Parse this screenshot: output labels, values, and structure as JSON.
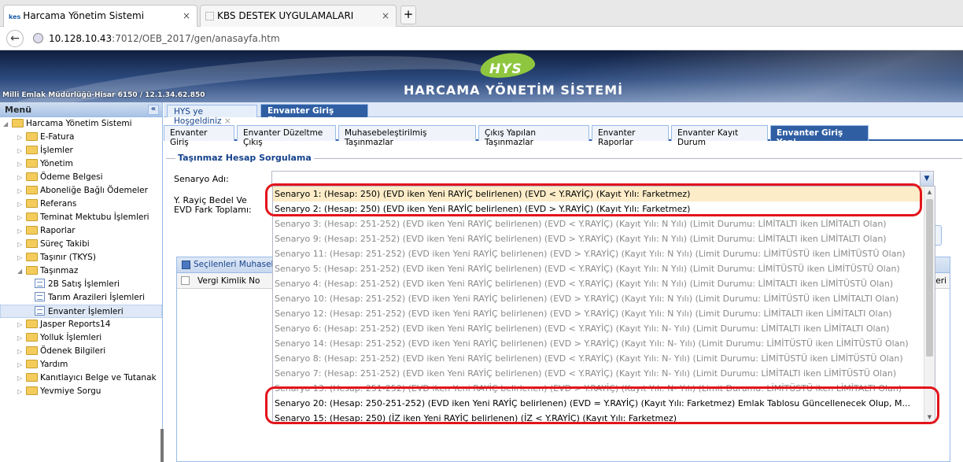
{
  "browser": {
    "tabs": [
      {
        "favicon": "kes",
        "title": "Harcama Yönetim Sistemi",
        "close": "×"
      },
      {
        "favicon": "",
        "title": "KBS DESTEK UYGULAMALARI",
        "close": "×"
      }
    ],
    "new_tab": "+",
    "url_host": "10.128.10.43",
    "url_path": ":7012/OEB_2017/gen/anasayfa.htm"
  },
  "banner": {
    "logo": "HYS",
    "system_title": "HARCAMA YÖNETİM SİSTEMİ",
    "unit_info": "Milli Emlak Müdürlüğü-Hisar 6150 / 12.1.34.62.850"
  },
  "menu": {
    "header": "Menü",
    "collapse": "«",
    "root": "Harcama Yönetim Sistemi",
    "items": [
      "E-Fatura",
      "İşlemler",
      "Yönetim",
      "Ödeme Belgesi",
      "Aboneliğe Bağlı Ödemeler",
      "Referans",
      "Teminat Mektubu İşlemleri",
      "Raporlar",
      "Süreç Takibi",
      "Taşınır (TKYS)"
    ],
    "open_item": "Taşınmaz",
    "subitems": [
      "2B Satış İşlemleri",
      "Tarım Arazileri İşlemleri",
      "Envanter İşlemleri"
    ],
    "items_after": [
      "Jasper Reports14",
      "Yolluk İşlemleri",
      "Ödenek Bilgileri",
      "Yardım",
      "Kanıtlayıcı Belge ve Tutanak",
      "Yevmiye Sorgu"
    ]
  },
  "outer_tabs": [
    {
      "label": "HYS ye Hoşgeldiniz",
      "close": "×"
    },
    {
      "label": "Envanter Giriş Ekranı",
      "close": "×"
    }
  ],
  "inner_tabs": [
    "Envanter Giriş",
    "Envanter Düzeltme Çıkış",
    "Muhasebeleştirilmiş Taşınmazlar",
    "Çıkış Yapılan Taşınmazlar",
    "Envanter Raporlar",
    "Envanter Kayıt Durum",
    "Envanter Giriş Yeni"
  ],
  "form": {
    "legend": "Taşınmaz Hesap Sorgulama",
    "senaryo_label": "Senaryo Adı:",
    "rayic_label_1": "Y. Rayiç Bedel Ve",
    "rayic_label_2": "EVD Fark Toplamı:"
  },
  "grid": {
    "title": "Seçilenleri Muhasebe",
    "col_vkn": "Vergi Kimlik No",
    "col_end": "eri"
  },
  "dropdown": {
    "options": [
      "Senaryo 1: (Hesap: 250) (EVD iken Yeni RAYİÇ belirlenen) (EVD < Y.RAYİÇ) (Kayıt Yılı: Farketmez)",
      "Senaryo 2: (Hesap: 250) (EVD iken Yeni RAYİÇ belirlenen) (EVD > Y.RAYİÇ) (Kayıt Yılı: Farketmez)",
      "Senaryo 3: (Hesap: 251-252) (EVD iken Yeni RAYİÇ belirlenen) (EVD < Y.RAYİÇ) (Kayıt Yılı: N Yılı) (Limit Durumu: LİMİTALTI iken LİMİTALTI Olan)",
      "Senaryo 9: (Hesap: 251-252) (EVD iken Yeni RAYİÇ belirlenen) (EVD > Y.RAYİÇ) (Kayıt Yılı: N Yılı) (Limit Durumu: LİMİTALTI iken LİMİTALTI Olan)",
      "Senaryo 11: (Hesap: 251-252) (EVD iken Yeni RAYİÇ belirlenen) (EVD > Y.RAYİÇ) (Kayıt Yılı: N Yılı) (Limit Durumu: LİMİTÜSTÜ iken LİMİTÜSTÜ Olan)",
      "Senaryo 5: (Hesap: 251-252) (EVD iken Yeni RAYİÇ belirlenen) (EVD < Y.RAYİÇ) (Kayıt Yılı: N Yılı) (Limit Durumu: LİMİTÜSTÜ iken LİMİTÜSTÜ Olan)",
      "Senaryo 4: (Hesap: 251-252) (EVD iken Yeni RAYİÇ belirlenen) (EVD < Y.RAYİÇ) (Kayıt Yılı: N Yılı) (Limit Durumu: LİMİTALTI iken LİMİTÜSTÜ Olan)",
      "Senaryo 10: (Hesap: 251-252) (EVD iken Yeni RAYİÇ belirlenen) (EVD > Y.RAYİÇ) (Kayıt Yılı: N Yılı) (Limit Durumu: LİMİTÜSTÜ iken LİMİTALTI Olan)",
      "Senaryo 12: (Hesap: 251-252) (EVD iken Yeni RAYİÇ belirlenen) (EVD > Y.RAYİÇ) (Kayıt Yılı: N Yılı) (Limit Durumu: LİMİTALTI iken LİMİTALTI Olan)",
      "Senaryo 6: (Hesap: 251-252) (EVD iken Yeni RAYİÇ belirlenen) (EVD < Y.RAYİÇ) (Kayıt Yılı: N- Yılı) (Limit Durumu: LİMİTALTI iken LİMİTALTI Olan)",
      "Senaryo 14: (Hesap: 251-252) (EVD iken Yeni RAYİÇ belirlenen) (EVD > Y.RAYİÇ) (Kayıt Yılı: N- Yılı) (Limit Durumu: LİMİTÜSTÜ iken LİMİTÜSTÜ Olan)",
      "Senaryo 8: (Hesap: 251-252) (EVD iken Yeni RAYİÇ belirlenen) (EVD < Y.RAYİÇ) (Kayıt Yılı: N- Yılı) (Limit Durumu: LİMİTÜSTÜ iken LİMİTÜSTÜ Olan)",
      "Senaryo 7: (Hesap: 251-252) (EVD iken Yeni RAYİÇ belirlenen) (EVD < Y.RAYİÇ) (Kayıt Yılı: N- Yılı) (Limit Durumu: LİMİTALTI iken LİMİTÜSTÜ Olan)",
      "Senaryo 13: (Hesap: 251-252) (EVD iken Yeni RAYİÇ belirlenen) (EVD > Y.RAYİÇ) (Kayıt Yılı: N- Yılı) (Limit Durumu: LİMİTÜSTÜ iken LİMİTALTI Olan)",
      "Senaryo 20: (Hesap: 250-251-252) (EVD iken Yeni RAYİÇ belirlenen) (EVD = Y.RAYİÇ) (Kayıt Yılı: Farketmez) Emlak Tablosu Güncellenecek Olup, M...",
      "Senaryo 15: (Hesap: 250) (İZ iken Yeni RAYİÇ belirlenen) (İZ < Y.RAYİÇ) (Kayıt Yılı: Farketmez)"
    ]
  },
  "colors": {
    "accent": "#2f5ea3",
    "highlight": "#e3141b",
    "panel_border": "#99bbe8"
  }
}
